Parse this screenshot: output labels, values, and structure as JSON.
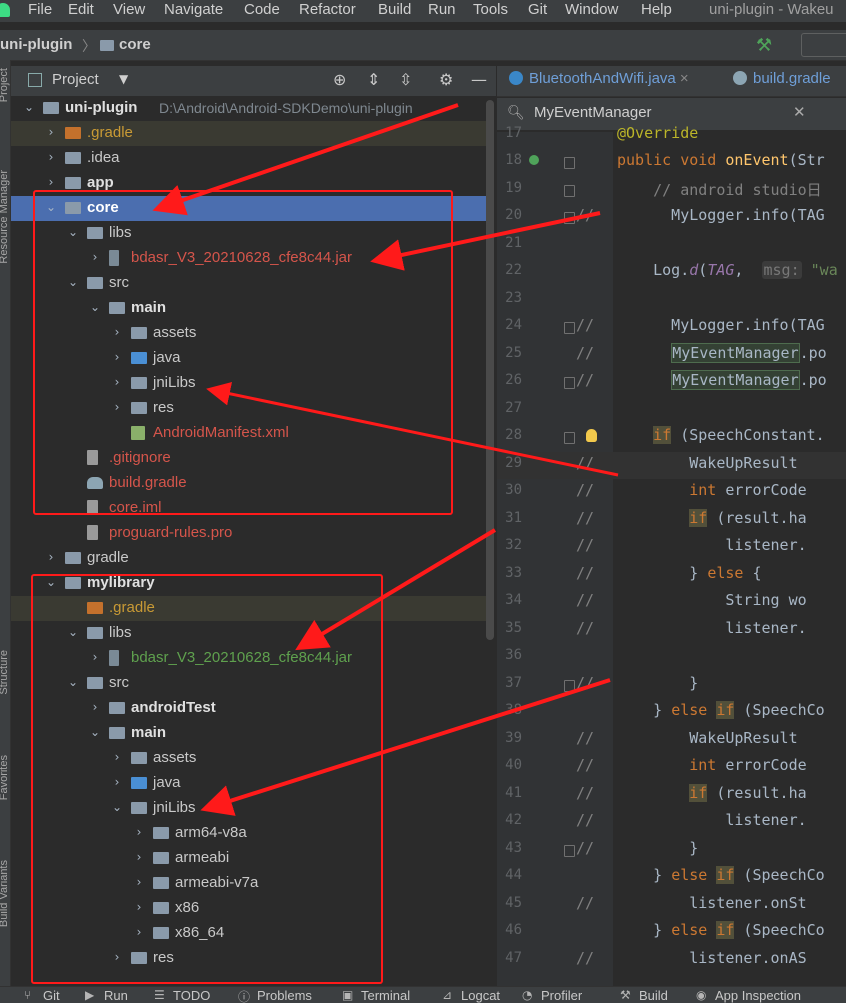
{
  "menu": {
    "items": [
      "File",
      "Edit",
      "View",
      "Navigate",
      "Code",
      "Refactor",
      "Build",
      "Run",
      "Tools",
      "Git",
      "Window",
      "Help"
    ],
    "window_title": "uni-plugin - Wakeu"
  },
  "navbar": {
    "project": "uni-plugin",
    "module": "core"
  },
  "left_strip": {
    "project": "Project",
    "resource_manager": "Resource Manager",
    "structure": "Structure",
    "favorites": "Favorites",
    "build_variants": "Build Variants"
  },
  "project_panel": {
    "title": "Project"
  },
  "tree": [
    {
      "label": "uni-plugin",
      "path": "D:\\Android\\Android-SDKDemo\\uni-plugin",
      "style": "bold",
      "expanded": true
    },
    {
      "label": ".gradle",
      "style": "orange",
      "expanded": false
    },
    {
      "label": ".idea",
      "style": "white",
      "expanded": false
    },
    {
      "label": "app",
      "style": "bold",
      "expanded": false
    },
    {
      "label": "core",
      "style": "bold",
      "expanded": true,
      "selected": true
    },
    {
      "label": "libs",
      "style": "white",
      "expanded": true
    },
    {
      "label": "bdasr_V3_20210628_cfe8c44.jar",
      "style": "red",
      "expanded": false
    },
    {
      "label": "src",
      "style": "white",
      "expanded": true
    },
    {
      "label": "main",
      "style": "bold",
      "expanded": true
    },
    {
      "label": "assets",
      "style": "white",
      "expanded": false
    },
    {
      "label": "java",
      "style": "white",
      "expanded": false
    },
    {
      "label": "jniLibs",
      "style": "white",
      "expanded": false
    },
    {
      "label": "res",
      "style": "white",
      "expanded": false
    },
    {
      "label": "AndroidManifest.xml",
      "style": "red"
    },
    {
      "label": ".gitignore",
      "style": "red"
    },
    {
      "label": "build.gradle",
      "style": "red"
    },
    {
      "label": "core.iml",
      "style": "red"
    },
    {
      "label": "proguard-rules.pro",
      "style": "red"
    },
    {
      "label": "gradle",
      "style": "white",
      "expanded": false
    },
    {
      "label": "mylibrary",
      "style": "bold",
      "expanded": true
    },
    {
      "label": ".gradle",
      "style": "orange"
    },
    {
      "label": "libs",
      "style": "white",
      "expanded": true
    },
    {
      "label": "bdasr_V3_20210628_cfe8c44.jar",
      "style": "green",
      "expanded": false
    },
    {
      "label": "src",
      "style": "white",
      "expanded": true
    },
    {
      "label": "androidTest",
      "style": "bold",
      "expanded": false
    },
    {
      "label": "main",
      "style": "bold",
      "expanded": true
    },
    {
      "label": "assets",
      "style": "white",
      "expanded": false
    },
    {
      "label": "java",
      "style": "white",
      "expanded": false
    },
    {
      "label": "jniLibs",
      "style": "white",
      "expanded": true
    },
    {
      "label": "arm64-v8a",
      "style": "white",
      "expanded": false
    },
    {
      "label": "armeabi",
      "style": "white",
      "expanded": false
    },
    {
      "label": "armeabi-v7a",
      "style": "white",
      "expanded": false
    },
    {
      "label": "x86",
      "style": "white",
      "expanded": false
    },
    {
      "label": "x86_64",
      "style": "white",
      "expanded": false
    },
    {
      "label": "res",
      "style": "white",
      "expanded": false
    }
  ],
  "editor": {
    "tabs": [
      "BluetoothAndWifi.java",
      "build.gradle"
    ],
    "search_value": "MyEventManager",
    "lines": [
      {
        "num": "17",
        "text": "@Override"
      },
      {
        "num": "18",
        "text": "public void onEvent(Str"
      },
      {
        "num": "19",
        "text": "    // android studio日"
      },
      {
        "num": "20",
        "text": "      MyLogger.info(TAG"
      },
      {
        "num": "21",
        "text": ""
      },
      {
        "num": "22",
        "text": "    Log.d(TAG,  msg: \"wa"
      },
      {
        "num": "23",
        "text": ""
      },
      {
        "num": "24",
        "text": "      MyLogger.info(TAG"
      },
      {
        "num": "25",
        "text": "      MyEventManager.po"
      },
      {
        "num": "26",
        "text": "      MyEventManager.po"
      },
      {
        "num": "27",
        "text": ""
      },
      {
        "num": "28",
        "text": "    if (SpeechConstant."
      },
      {
        "num": "29",
        "text": "        WakeUpResult "
      },
      {
        "num": "30",
        "text": "        int errorCode"
      },
      {
        "num": "31",
        "text": "        if (result.ha"
      },
      {
        "num": "32",
        "text": "            listener."
      },
      {
        "num": "33",
        "text": "        } else {"
      },
      {
        "num": "34",
        "text": "            String wo"
      },
      {
        "num": "35",
        "text": "            listener."
      },
      {
        "num": "36",
        "text": ""
      },
      {
        "num": "37",
        "text": "        }"
      },
      {
        "num": "38",
        "text": "    } else if (SpeechCo"
      },
      {
        "num": "39",
        "text": "        WakeUpResult "
      },
      {
        "num": "40",
        "text": "        int errorCode"
      },
      {
        "num": "41",
        "text": "        if (result.ha"
      },
      {
        "num": "42",
        "text": "            listener."
      },
      {
        "num": "43",
        "text": "        }"
      },
      {
        "num": "44",
        "text": "    } else if (SpeechCo"
      },
      {
        "num": "45",
        "text": "        listener.onSt"
      },
      {
        "num": "46",
        "text": "    } else if (SpeechCo"
      },
      {
        "num": "47",
        "text": "        listener.onAS"
      }
    ]
  },
  "statusbar": [
    "Git",
    "Run",
    "TODO",
    "Problems",
    "Terminal",
    "Logcat",
    "Profiler",
    "Build",
    "App Inspection"
  ],
  "colors": {
    "selection": "#4b6eaf",
    "annotation": "#ff1a1a",
    "background": "#2b2b2b"
  }
}
